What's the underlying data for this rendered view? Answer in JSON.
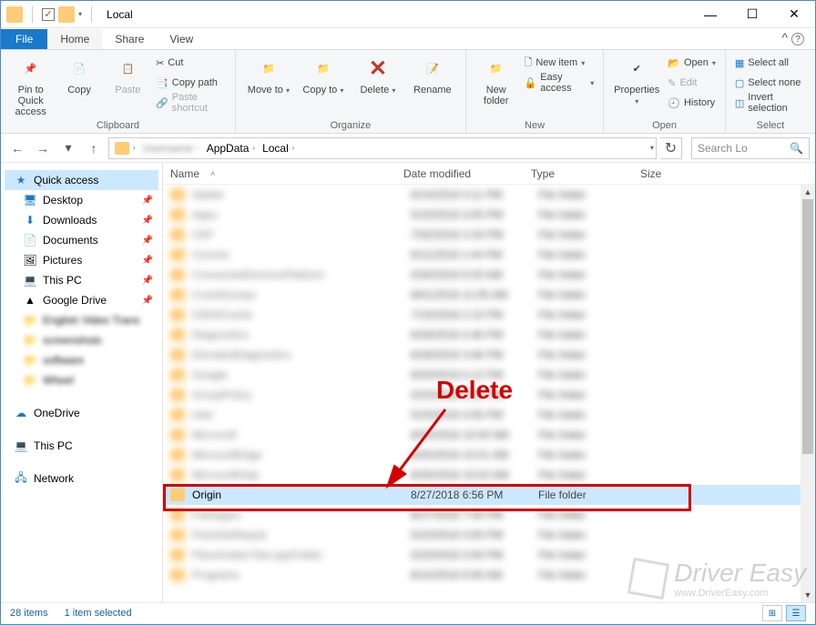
{
  "window": {
    "title": "Local"
  },
  "titlebar": {
    "min": "—",
    "max": "☐",
    "close": "✕"
  },
  "tabs": {
    "file": "File",
    "home": "Home",
    "share": "Share",
    "view": "View"
  },
  "ribbon": {
    "clipboard": {
      "label": "Clipboard",
      "pin": "Pin to Quick access",
      "copy": "Copy",
      "paste": "Paste",
      "cut": "Cut",
      "copypath": "Copy path",
      "pasteshort": "Paste shortcut"
    },
    "organize": {
      "label": "Organize",
      "moveto": "Move to",
      "copyto": "Copy to",
      "delete": "Delete",
      "rename": "Rename"
    },
    "new": {
      "label": "New",
      "newfolder": "New folder",
      "newitem": "New item",
      "easyaccess": "Easy access"
    },
    "open": {
      "label": "Open",
      "properties": "Properties",
      "open": "Open",
      "edit": "Edit",
      "history": "History"
    },
    "select": {
      "label": "Select",
      "selectall": "Select all",
      "selectnone": "Select none",
      "invert": "Invert selection"
    }
  },
  "address": {
    "back": "←",
    "forward": "→",
    "up": "↑",
    "refresh": "↻",
    "blurred_user": "Username",
    "crumb1": "AppData",
    "crumb2": "Local",
    "search_placeholder": "Search Lo"
  },
  "sidebar": {
    "quick": "Quick access",
    "desktop": "Desktop",
    "downloads": "Downloads",
    "documents": "Documents",
    "pictures": "Pictures",
    "thispc": "This PC",
    "gdrive": "Google Drive",
    "b1": "English Video Trans",
    "b2": "screenshots",
    "b3": "software",
    "b4": "Wheel",
    "onedrive": "OneDrive",
    "thispc2": "This PC",
    "network": "Network"
  },
  "columns": {
    "name": "Name",
    "date": "Date modified",
    "type": "Type",
    "size": "Size"
  },
  "files": {
    "selected": {
      "name": "Origin",
      "date": "8/27/2018 6:56 PM",
      "type": "File folder"
    },
    "blurred": [
      {
        "n": "Adobe",
        "d": "6/14/2018 4:11 PM",
        "t": "File folder"
      },
      {
        "n": "Apps",
        "d": "5/23/2018 3:00 PM",
        "t": "File folder"
      },
      {
        "n": "CEF",
        "d": "7/02/2018 2:33 PM",
        "t": "File folder"
      },
      {
        "n": "Comms",
        "d": "6/11/2018 1:44 PM",
        "t": "File folder"
      },
      {
        "n": "ConnectedDevicesPlatform",
        "d": "5/30/2018 9:20 AM",
        "t": "File folder"
      },
      {
        "n": "CrashDumps",
        "d": "8/01/2018 11:05 AM",
        "t": "File folder"
      },
      {
        "n": "D3DSCache",
        "d": "7/15/2018 2:10 PM",
        "t": "File folder"
      },
      {
        "n": "Diagnostics",
        "d": "6/28/2018 3:45 PM",
        "t": "File folder"
      },
      {
        "n": "ElevatedDiagnostics",
        "d": "6/28/2018 3:46 PM",
        "t": "File folder"
      },
      {
        "n": "Google",
        "d": "8/20/2018 5:12 PM",
        "t": "File folder"
      },
      {
        "n": "GroupPolicy",
        "d": "5/23/2018 3:01 PM",
        "t": "File folder"
      },
      {
        "n": "Intel",
        "d": "5/23/2018 3:05 PM",
        "t": "File folder"
      },
      {
        "n": "Microsoft",
        "d": "8/25/2018 10:00 AM",
        "t": "File folder"
      },
      {
        "n": "MicrosoftEdge",
        "d": "8/25/2018 10:01 AM",
        "t": "File folder"
      },
      {
        "n": "MicrosoftHelp",
        "d": "8/25/2018 10:02 AM",
        "t": "File folder"
      }
    ],
    "blurred_after": [
      {
        "n": "Packages",
        "d": "8/27/2018 7:00 PM",
        "t": "File folder"
      },
      {
        "n": "PeerDistRepub",
        "d": "5/23/2018 3:00 PM",
        "t": "File folder"
      },
      {
        "n": "PlaceholderTileLogoFolder",
        "d": "5/23/2018 3:00 PM",
        "t": "File folder"
      },
      {
        "n": "Programs",
        "d": "8/10/2018 9:00 AM",
        "t": "File folder"
      }
    ]
  },
  "status": {
    "items": "28 items",
    "selected": "1 item selected"
  },
  "annotation": {
    "delete": "Delete"
  },
  "watermark": {
    "brand": "Driver Easy",
    "url": "www.DriverEasy.com"
  }
}
